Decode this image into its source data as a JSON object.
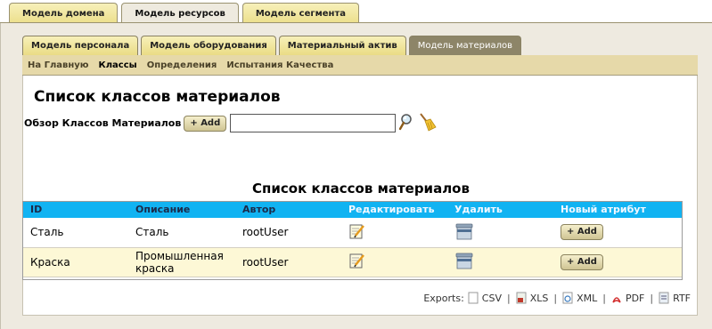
{
  "top_tabs": [
    "Модель домена",
    "Модель ресурсов",
    "Модель сегмента"
  ],
  "sub_tabs": [
    "Модель персонала",
    "Модель оборудования",
    "Материальный актив",
    "Модель материалов"
  ],
  "subnav": [
    "На Главную",
    "Классы",
    "Определения",
    "Испытания Качества"
  ],
  "page": {
    "title": "Список классов материалов",
    "browse_label": "Обзор Классов Материалов",
    "add_label": "+ Add",
    "search_value": ""
  },
  "table": {
    "title": "Список классов материалов",
    "columns": [
      "ID",
      "Описание",
      "Автор",
      "Редактировать",
      "Удалить",
      "Новый атрибут"
    ],
    "rows": [
      {
        "id": "Сталь",
        "description": "Сталь",
        "author": "rootUser",
        "add_label": "+ Add"
      },
      {
        "id": "Краска",
        "description": "Промышленная краска",
        "author": "rootUser",
        "add_label": "+ Add"
      }
    ]
  },
  "exports": {
    "label": "Exports:",
    "items": [
      "CSV",
      "XLS",
      "XML",
      "PDF",
      "RTF"
    ],
    "separator": "|"
  },
  "icons": {
    "search": "magnifier-icon",
    "clear": "broom-icon",
    "edit": "notepad-pencil-icon",
    "delete": "trash-bin-icon"
  },
  "colors": {
    "header_blue": "#11b3f2",
    "tab_yellow": "#f7f0b9",
    "active_tab": "#8d8568",
    "row_alt": "#fdf8d6"
  }
}
